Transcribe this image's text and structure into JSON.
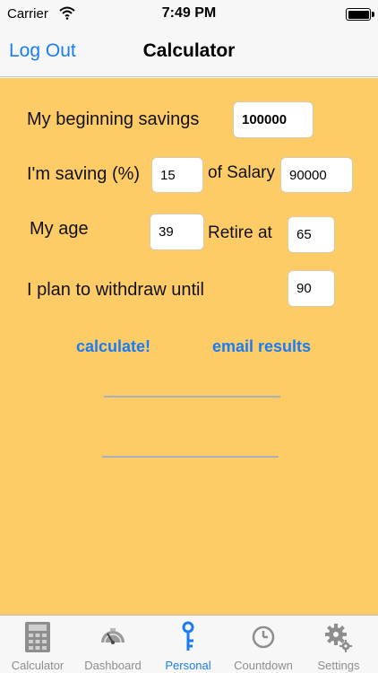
{
  "status": {
    "carrier": "Carrier",
    "time": "7:49 PM"
  },
  "nav": {
    "back_label": "Log Out",
    "title": "Calculator"
  },
  "form": {
    "beginning_savings_label": "My beginning savings",
    "beginning_savings_value": "100000",
    "saving_percent_label": "I'm saving (%)",
    "saving_percent_value": "15",
    "of_salary_label": "of Salary",
    "salary_value": "90000",
    "age_label": "My age",
    "age_value": "39",
    "retire_label": "Retire at",
    "retire_value": "65",
    "withdraw_label": "I plan to withdraw until",
    "withdraw_value": "90"
  },
  "actions": {
    "calculate_label": "calculate!",
    "email_label": "email results"
  },
  "tabs": [
    {
      "label": "Calculator",
      "icon": "calculator-icon"
    },
    {
      "label": "Dashboard",
      "icon": "dashboard-icon"
    },
    {
      "label": "Personal",
      "icon": "key-icon",
      "active": true
    },
    {
      "label": "Countdown",
      "icon": "clock-icon"
    },
    {
      "label": "Settings",
      "icon": "gear-icon"
    }
  ],
  "colors": {
    "accent": "#1a7cf5",
    "background": "#fecc66"
  }
}
